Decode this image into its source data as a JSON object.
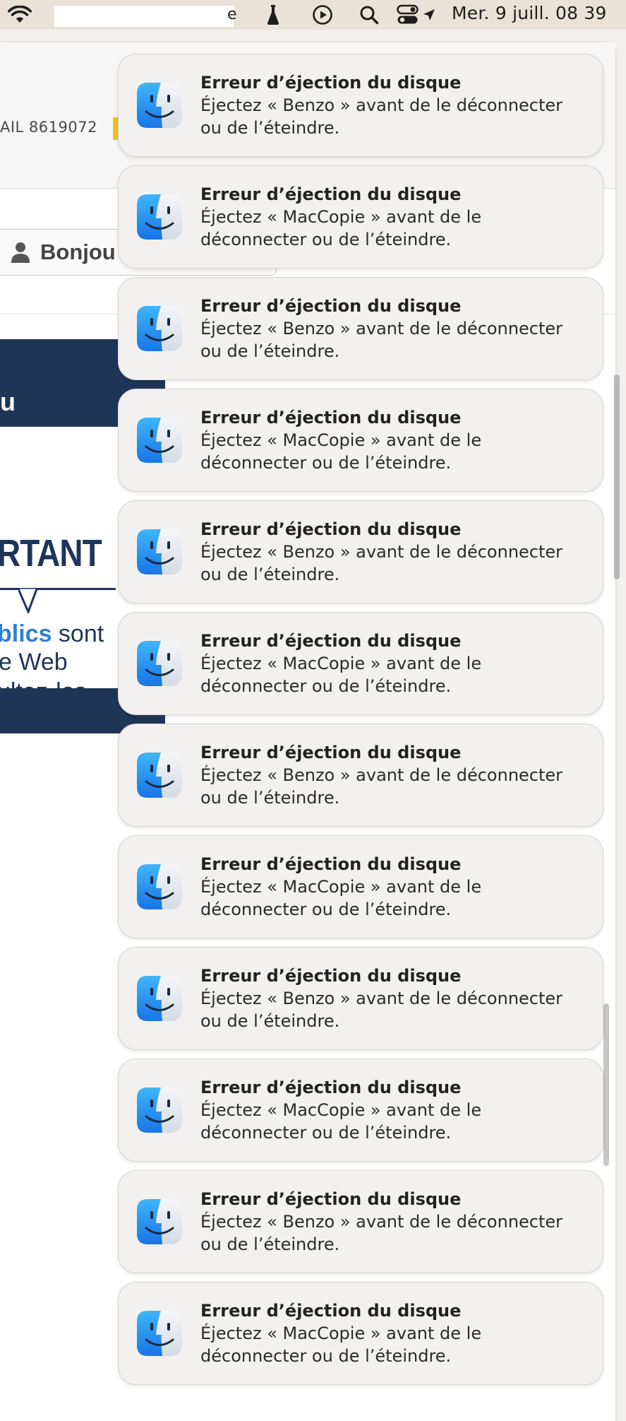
{
  "menubar": {
    "redacted_tail": "e",
    "clock": "Mer. 9 juill. 08 39",
    "icons": [
      "wifi-icon",
      "flask-icon",
      "play-circle-icon",
      "search-icon",
      "control-center-icon",
      "location-arrow-icon"
    ]
  },
  "background_window": {
    "reference_text": "AIL 8619072",
    "login_label": "Bonjou",
    "banner": {
      "heading_fragment": "u",
      "important_fragment": "RTANT",
      "line1_highlight": "blics",
      "line1_rest": " sont",
      "line2": "e Web",
      "line3": "ultez-les"
    }
  },
  "notifications": [
    {
      "title": "Erreur d’éjection du disque",
      "body": "Éjectez « Benzo » avant de le déconnecter ou de l’éteindre."
    },
    {
      "title": "Erreur d’éjection du disque",
      "body": "Éjectez « MacCopie » avant de le déconnecter ou de l’éteindre."
    },
    {
      "title": "Erreur d’éjection du disque",
      "body": "Éjectez « Benzo » avant de le déconnecter ou de l’éteindre."
    },
    {
      "title": "Erreur d’éjection du disque",
      "body": "Éjectez « MacCopie » avant de le déconnecter ou de l’éteindre."
    },
    {
      "title": "Erreur d’éjection du disque",
      "body": "Éjectez « Benzo » avant de le déconnecter ou de l’éteindre."
    },
    {
      "title": "Erreur d’éjection du disque",
      "body": "Éjectez « MacCopie » avant de le déconnecter ou de l’éteindre."
    },
    {
      "title": "Erreur d’éjection du disque",
      "body": "Éjectez « Benzo » avant de le déconnecter ou de l’éteindre."
    },
    {
      "title": "Erreur d’éjection du disque",
      "body": "Éjectez « MacCopie » avant de le déconnecter ou de l’éteindre."
    },
    {
      "title": "Erreur d’éjection du disque",
      "body": "Éjectez « Benzo » avant de le déconnecter ou de l’éteindre."
    },
    {
      "title": "Erreur d’éjection du disque",
      "body": "Éjectez « MacCopie » avant de le déconnecter ou de l’éteindre."
    },
    {
      "title": "Erreur d’éjection du disque",
      "body": "Éjectez « Benzo » avant de le déconnecter ou de l’éteindre."
    },
    {
      "title": "Erreur d’éjection du disque",
      "body": "Éjectez « MacCopie » avant de le déconnecter ou de l’éteindre."
    }
  ],
  "notification_icon": "finder-icon",
  "colors": {
    "menubar": "#e9e2d6",
    "banner_navy": "#1f3558",
    "banner_highlight": "#2f7fd6",
    "notification_bg": "#f3f1ef"
  }
}
